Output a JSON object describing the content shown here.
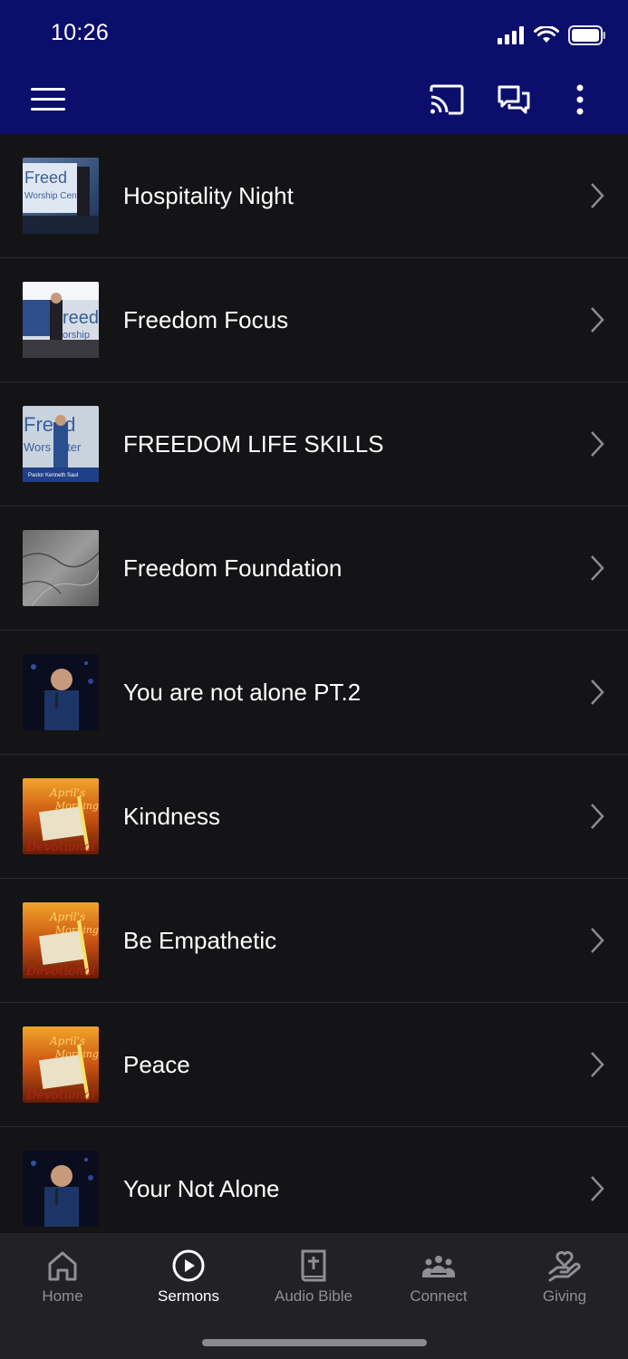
{
  "status_bar": {
    "time": "10:26"
  },
  "header": {
    "menu_icon": "hamburger-menu-icon",
    "cast_icon": "cast-icon",
    "chat_icon": "chat-bubbles-icon",
    "more_icon": "vertical-dots-icon"
  },
  "sermons": [
    {
      "title": "Hospitality Night"
    },
    {
      "title": "Freedom Focus"
    },
    {
      "title": "FREEDOM LIFE SKILLS"
    },
    {
      "title": "Freedom Foundation"
    },
    {
      "title": "You are not alone PT.2"
    },
    {
      "title": "Kindness"
    },
    {
      "title": "Be Empathetic"
    },
    {
      "title": "Peace"
    },
    {
      "title": "Your Not Alone"
    }
  ],
  "tabs": [
    {
      "label": "Home",
      "icon": "home-icon",
      "active": false
    },
    {
      "label": "Sermons",
      "icon": "play-circle-icon",
      "active": true
    },
    {
      "label": "Audio Bible",
      "icon": "bible-icon",
      "active": false
    },
    {
      "label": "Connect",
      "icon": "group-icon",
      "active": false
    },
    {
      "label": "Giving",
      "icon": "hand-heart-icon",
      "active": false
    }
  ],
  "colors": {
    "header_bg": "#0b0f6b",
    "list_bg": "#141417",
    "tabbar_bg": "#222226",
    "active_tab": "#ffffff",
    "inactive_tab": "#8f8f96"
  }
}
